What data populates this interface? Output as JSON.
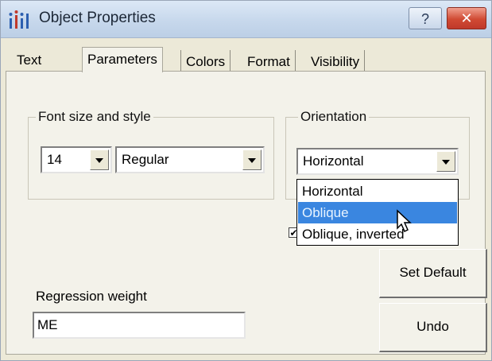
{
  "window": {
    "title": "Object Properties",
    "help_label": "?",
    "close_label": "✕"
  },
  "tabs": [
    {
      "label": "Text"
    },
    {
      "label": "Parameters"
    },
    {
      "label": "Colors"
    },
    {
      "label": "Format"
    },
    {
      "label": "Visibility"
    }
  ],
  "font_group": {
    "title": "Font size and style",
    "size_value": "14",
    "style_value": "Regular"
  },
  "orientation_group": {
    "title": "Orientation",
    "value": "Horizontal",
    "options": [
      "Horizontal",
      "Oblique",
      "Oblique, inverted"
    ],
    "highlighted_option": "Oblique"
  },
  "checkbox": {
    "checked_glyph": "✔"
  },
  "buttons": {
    "set_default": "Set Default",
    "undo": "Undo"
  },
  "regression": {
    "label": "Regression weight",
    "value": "ME"
  },
  "colors": {
    "selected_item": "#3a86e0",
    "close_button": "#c0392b"
  }
}
